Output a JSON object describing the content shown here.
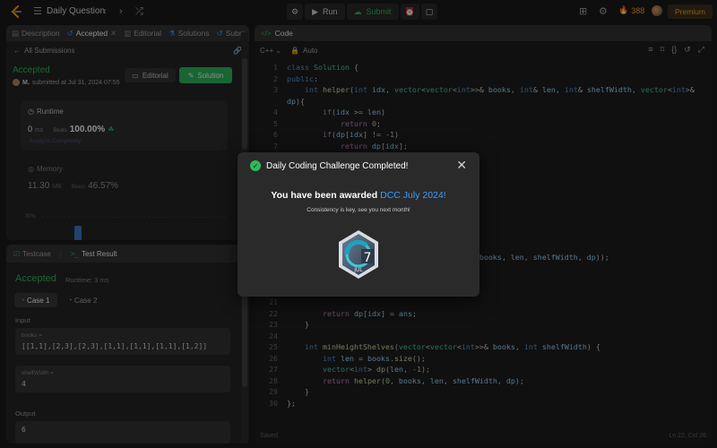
{
  "topbar": {
    "title": "Daily Question",
    "run_label": "Run",
    "submit_label": "Submit",
    "streak": "388",
    "premium_label": "Premium"
  },
  "left_tabs": [
    {
      "label": "Description"
    },
    {
      "label": "Accepted"
    },
    {
      "label": "Editorial"
    },
    {
      "label": "Solutions"
    },
    {
      "label": "Subm"
    }
  ],
  "submission": {
    "back_label": "All Submissions",
    "status": "Accepted",
    "user": "M.",
    "submitted_at": "submitted at Jul 31, 2024 07:55",
    "editorial_label": "Editorial",
    "solution_label": "Solution",
    "runtime_label": "Runtime",
    "runtime_value": "0",
    "runtime_unit": "ms",
    "beats_label": "Beats",
    "runtime_beats": "100.00%",
    "analyze_label": "Analyze Complexity",
    "memory_label": "Memory",
    "memory_value": "11.30",
    "memory_unit": "MB",
    "memory_beats": "46.57%",
    "dist_label": "30%"
  },
  "bottom_tabs": [
    {
      "label": "Testcase"
    },
    {
      "label": "Test Result"
    }
  ],
  "result": {
    "status": "Accepted",
    "runtime": "Runtime: 3 ms",
    "case1": "Case 1",
    "case2": "Case 2",
    "input_label": "Input",
    "books_name": "books =",
    "books_value": "[[1,1],[2,3],[2,3],[1,1],[1,1],[1,1],[1,2]]",
    "shelf_name": "shelfWidth =",
    "shelf_value": "4",
    "output_label": "Output",
    "output_value": "6"
  },
  "code_panel": {
    "title": "Code",
    "language": "C++",
    "mode": "Auto",
    "saved": "Saved",
    "position": "Ln 22, Col 26"
  },
  "modal": {
    "title": "Daily Coding Challenge Completed!",
    "award_prefix": "You have been awarded",
    "award_name": "DCC July 2024!",
    "subtitle": "Consistency is key, see you next month!",
    "badge_number": "7",
    "badge_month": "JUL"
  }
}
